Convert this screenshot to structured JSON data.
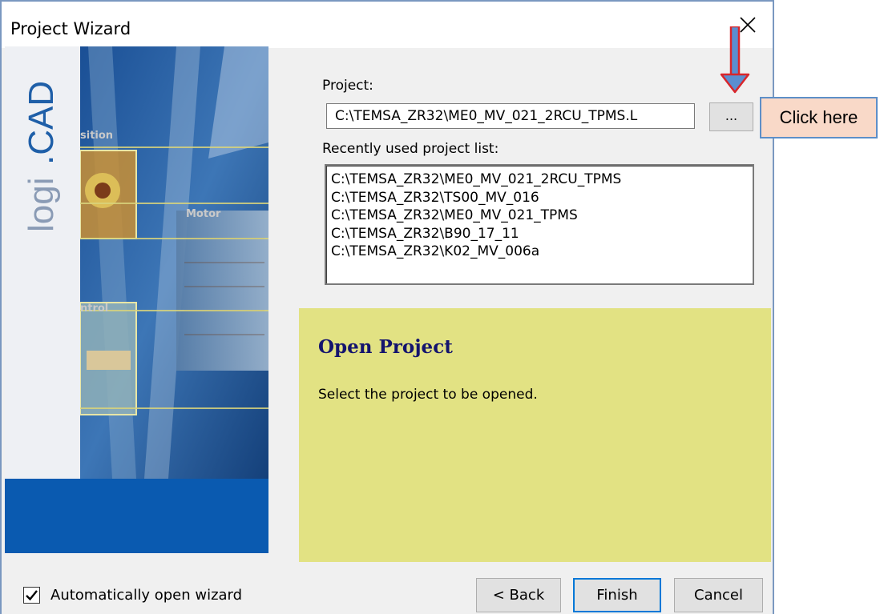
{
  "window": {
    "title": "Project Wizard"
  },
  "banner": {
    "logo_text": "logi.CAD",
    "tags": [
      "sition",
      "Motor",
      "ntrol"
    ]
  },
  "project": {
    "label": "Project:",
    "value": "C:\\TEMSA_ZR32\\ME0_MV_021_2RCU_TPMS.L",
    "browse_label": "..."
  },
  "recent": {
    "label": "Recently used project list:",
    "items": [
      "C:\\TEMSA_ZR32\\ME0_MV_021_2RCU_TPMS",
      "C:\\TEMSA_ZR32\\TS00_MV_016",
      "C:\\TEMSA_ZR32\\ME0_MV_021_TPMS",
      "C:\\TEMSA_ZR32\\B90_17_11",
      "C:\\TEMSA_ZR32\\K02_MV_006a"
    ]
  },
  "info": {
    "title": "Open Project",
    "description": "Select the project to be opened."
  },
  "footer": {
    "auto_open_label": "Automatically open wizard",
    "auto_open_checked": true,
    "back_label": "< Back",
    "finish_label": "Finish",
    "cancel_label": "Cancel"
  },
  "annotation": {
    "callout_text": "Click here"
  },
  "colors": {
    "info_bg": "#e2e283",
    "info_title": "#14146e",
    "banner_blue": "#0a5ab0",
    "callout_bg": "#f9d9c8",
    "arrow_red": "#d8262b"
  }
}
